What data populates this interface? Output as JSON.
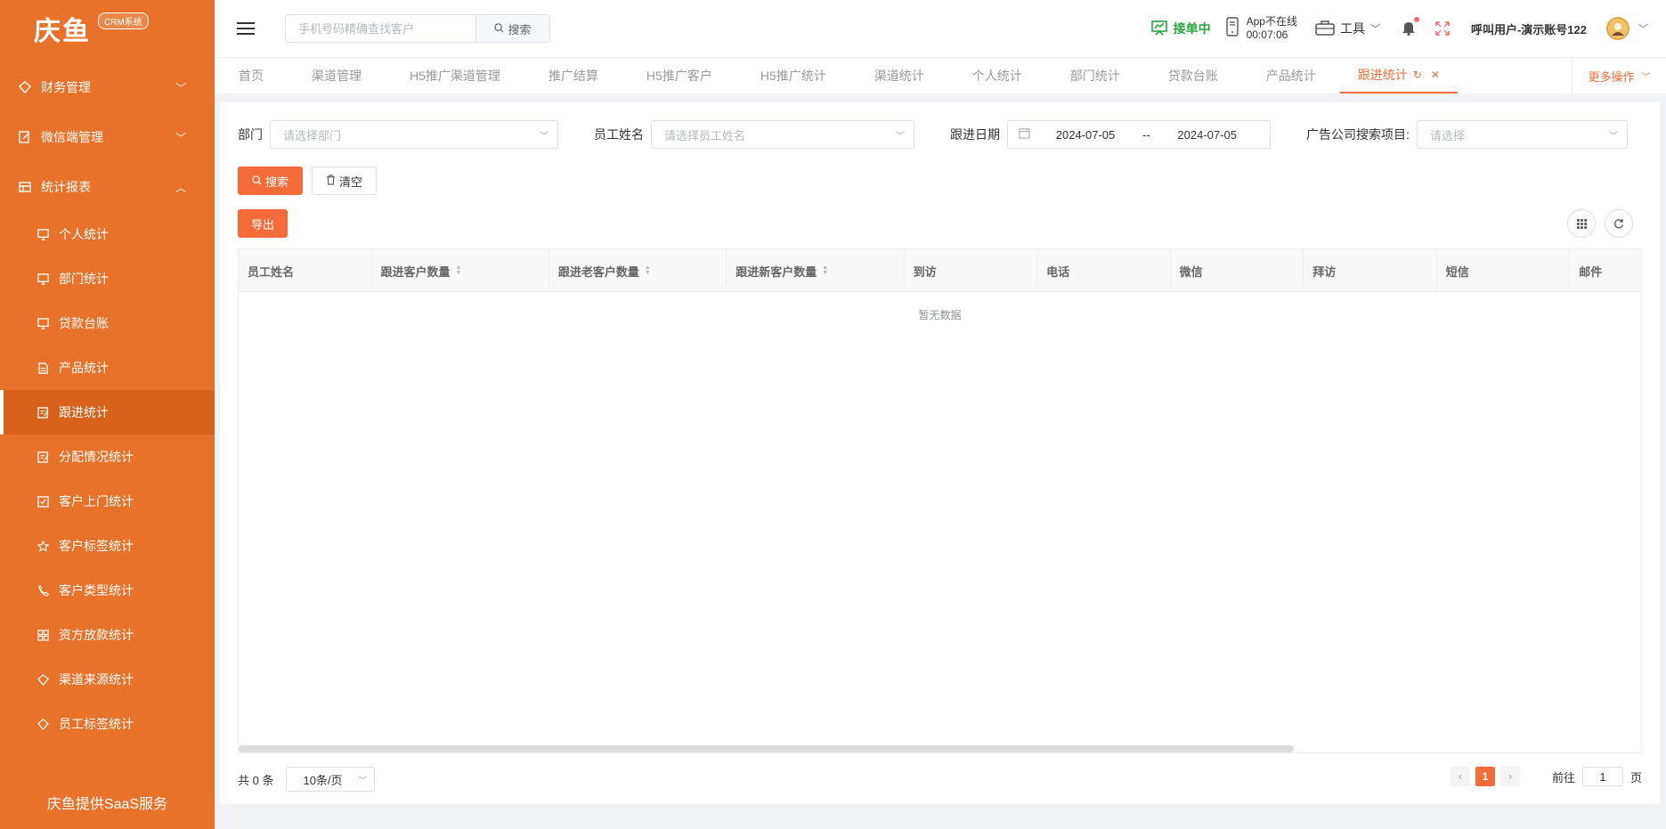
{
  "brand": {
    "name": "庆鱼",
    "badge": "CRM系统",
    "footer": "庆鱼提供SaaS服务",
    "accent": "#e8722a",
    "primary": "#f56c3a"
  },
  "sidebar": {
    "groups": [
      {
        "label": "财务管理",
        "icon": "finance-icon",
        "expanded": false
      },
      {
        "label": "微信端管理",
        "icon": "wechat-manage-icon",
        "expanded": false
      },
      {
        "label": "统计报表",
        "icon": "report-icon",
        "expanded": true
      }
    ],
    "items": [
      {
        "label": "个人统计",
        "icon": "monitor-icon"
      },
      {
        "label": "部门统计",
        "icon": "monitor-icon"
      },
      {
        "label": "贷款台账",
        "icon": "monitor-icon"
      },
      {
        "label": "产品统计",
        "icon": "document-icon"
      },
      {
        "label": "跟进统计",
        "icon": "edit-icon",
        "active": true
      },
      {
        "label": "分配情况统计",
        "icon": "edit-icon"
      },
      {
        "label": "客户上门统计",
        "icon": "checkbox-icon"
      },
      {
        "label": "客户标签统计",
        "icon": "star-icon"
      },
      {
        "label": "客户类型统计",
        "icon": "phone-icon"
      },
      {
        "label": "资方放款统计",
        "icon": "grid-icon"
      },
      {
        "label": "渠道来源统计",
        "icon": "tag-icon"
      },
      {
        "label": "员工标签统计",
        "icon": "tag-icon"
      }
    ]
  },
  "header": {
    "search_placeholder": "手机号码精确查找客户",
    "search_button": "搜索",
    "accept_status": "接单中",
    "app_status": "App不在线",
    "app_timer": "00:07:06",
    "tools": "工具",
    "user": "呼叫用户-演示账号122"
  },
  "tabs": [
    {
      "label": "首页"
    },
    {
      "label": "渠道管理"
    },
    {
      "label": "H5推广渠道管理"
    },
    {
      "label": "推广结算"
    },
    {
      "label": "H5推广客户"
    },
    {
      "label": "H5推广统计"
    },
    {
      "label": "渠道统计"
    },
    {
      "label": "个人统计"
    },
    {
      "label": "部门统计"
    },
    {
      "label": "贷款台账"
    },
    {
      "label": "产品统计"
    },
    {
      "label": "跟进统计",
      "active": true
    }
  ],
  "more_ops": "更多操作",
  "filters": {
    "dept_label": "部门",
    "dept_placeholder": "请选择部门",
    "staff_label": "员工姓名",
    "staff_placeholder": "请选择员工姓名",
    "date_label": "跟进日期",
    "date_start": "2024-07-05",
    "date_sep": "--",
    "date_end": "2024-07-05",
    "ad_label": "广告公司搜索项目:",
    "ad_placeholder": "请选择"
  },
  "buttons": {
    "search": "搜索",
    "clear": "清空",
    "export": "导出"
  },
  "table": {
    "columns": [
      "员工姓名",
      "跟进客户数量",
      "跟进老客户数量",
      "跟进新客户数量",
      "到访",
      "电话",
      "微信",
      "拜访",
      "短信",
      "邮件"
    ],
    "empty_text": "暂无数据"
  },
  "pagination": {
    "total": "共 0 条",
    "page_size": "10条/页",
    "current": "1",
    "goto_prefix": "前往",
    "goto_value": "1",
    "goto_suffix": "页"
  }
}
